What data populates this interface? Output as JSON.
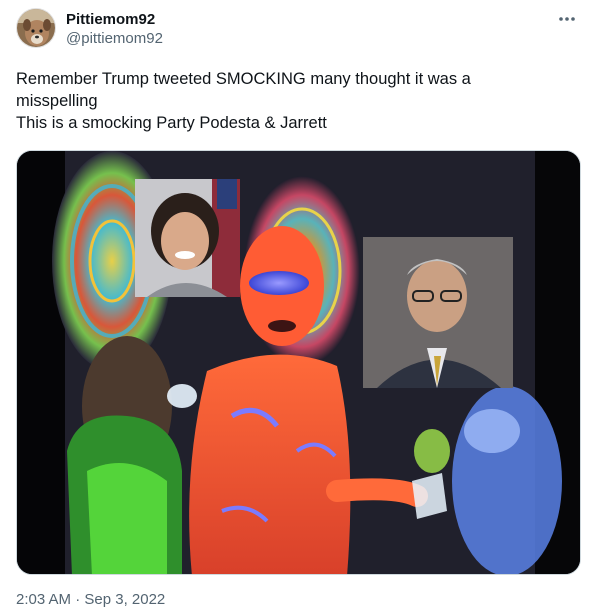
{
  "author": {
    "display_name": "Pittiemom92",
    "handle": "@pittiemom92",
    "avatar_icon": "dog-photo-avatar"
  },
  "tweet": {
    "lines": [
      "Remember Trump tweeted SMOCKING many thought it was a",
      "misspelling",
      "This is a smocking Party Podesta & Jarrett"
    ],
    "timestamp": "2:03 AM · Sep 3, 2022"
  },
  "menu": {
    "icon": "more-horizontal-icon"
  },
  "colors": {
    "text_primary": "#0f1419",
    "text_secondary": "#536471",
    "border": "#cfd9de"
  }
}
